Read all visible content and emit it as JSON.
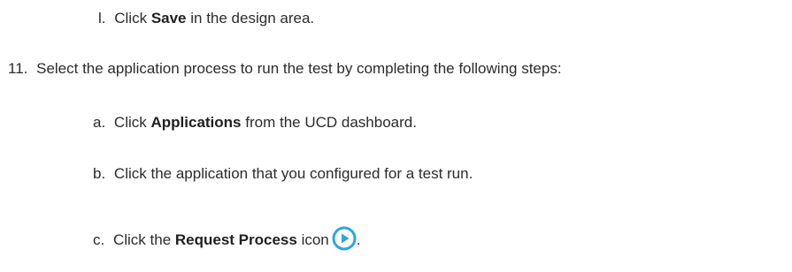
{
  "steps": {
    "step_l": {
      "marker": "l.",
      "pre": "Click",
      "bold": "Save",
      "post": "in the design area."
    },
    "step_11": {
      "marker": "11.",
      "text": "Select the application process to run the test by completing the following steps:"
    },
    "step_a": {
      "marker": "a.",
      "pre": "Click",
      "bold": "Applications",
      "post": "from the UCD dashboard."
    },
    "step_b": {
      "marker": "b.",
      "text": "Click the application that you configured for a test run."
    },
    "step_c": {
      "marker": "c.",
      "pre": "Click the",
      "bold": "Request Process",
      "post": "icon",
      "end": ".",
      "icon": "request-process-icon",
      "icon_color": "#2aa7e0"
    }
  }
}
